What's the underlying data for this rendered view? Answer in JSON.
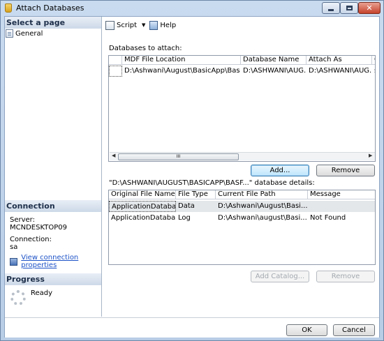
{
  "window": {
    "title": "Attach Databases",
    "close_glyph": "✕"
  },
  "left": {
    "select_page_header": "Select a page",
    "pages": [
      {
        "label": "General"
      }
    ],
    "connection_header": "Connection",
    "server_label": "Server:",
    "server_value": "MCNDESKTOP09",
    "connection_label": "Connection:",
    "connection_value": "sa",
    "view_props_link": "View connection properties",
    "progress_header": "Progress",
    "progress_status": "Ready"
  },
  "toolbar": {
    "script_label": "Script",
    "help_label": "Help"
  },
  "attach": {
    "label": "Databases to attach:",
    "columns": [
      "MDF File Location",
      "Database Name",
      "Attach As",
      "O"
    ],
    "rows": [
      {
        "mdf": "D:\\Ashwani\\August\\BasicApp\\Basi...",
        "db_name": "D:\\ASHWANI\\AUG...",
        "attach_as": "D:\\ASHWANI\\AUG...",
        "extra": "s"
      }
    ],
    "browse_glyph": "...",
    "scroll_thumb_grip": "III",
    "add_button": "Add...",
    "remove_button": "Remove"
  },
  "details": {
    "label": "\"D:\\ASHWANI\\AUGUST\\BASICAPP\\BASF...\" database details:",
    "columns": [
      "Original File Name",
      "File Type",
      "Current File Path",
      "Message"
    ],
    "rows": [
      {
        "name": "ApplicationDatabas...",
        "type": "Data",
        "path": "D:\\Ashwani\\August\\Basi...",
        "message": ""
      },
      {
        "name": "ApplicationDatabas...",
        "type": "Log",
        "path": "D:\\Ashwani\\august\\Basi...",
        "message": "Not Found"
      }
    ],
    "browse_glyph": "...",
    "add_catalog_button": "Add Catalog...",
    "remove_button": "Remove"
  },
  "footer": {
    "ok_button": "OK",
    "cancel_button": "Cancel"
  }
}
